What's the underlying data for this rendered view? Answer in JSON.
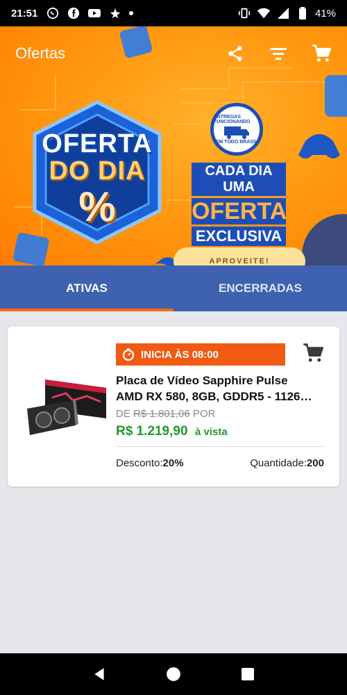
{
  "status_bar": {
    "time": "21:51",
    "battery": "41%",
    "icons": [
      "whatsapp-icon",
      "facebook-icon",
      "youtube-icon",
      "notification-app-icon"
    ]
  },
  "app_bar": {
    "title": "Ofertas",
    "actions": [
      "share-icon",
      "filter-icon",
      "cart-icon"
    ]
  },
  "banner": {
    "badge_line1": "OFERTA",
    "badge_line2": "DO DIA",
    "badge_symbol": "%",
    "seal_line1": "ENTREGAS FUNCIONANDO",
    "seal_line2": "EM TODO BRASIL",
    "promo_line1": "CADA DIA UMA",
    "promo_line2": "OFERTA",
    "promo_line3": "EXCLUSIVA",
    "cta_label": "APROVEITE!",
    "colors": {
      "background": "#ff9a12",
      "badge_blue": "#1d4eb8",
      "cta": "#fde39a"
    }
  },
  "tabs": [
    {
      "label": "ATIVAS",
      "active": true
    },
    {
      "label": "ENCERRADAS",
      "active": false
    }
  ],
  "offer": {
    "timer_label": "INICIA ÀS 08:00",
    "name_line1": "Placa de Vídeo Sapphire Pulse",
    "name_line2": "AMD RX 580, 8GB, GDDR5 - 1126…",
    "old_price_prefix": "DE",
    "old_price": "R$ 1.801,06",
    "old_price_suffix": "POR",
    "price": "R$ 1.219,90",
    "price_suffix": "à vista",
    "discount_label": "Desconto:",
    "discount_value": "20%",
    "quantity_label": "Quantidade:",
    "quantity_value": "200",
    "colors": {
      "timer": "#f05a13",
      "price": "#1f9a2e"
    }
  },
  "colors": {
    "tabs_bg": "#3f62b0",
    "tab_indicator": "#ff6a13",
    "page_bg": "#e6e7eb"
  }
}
